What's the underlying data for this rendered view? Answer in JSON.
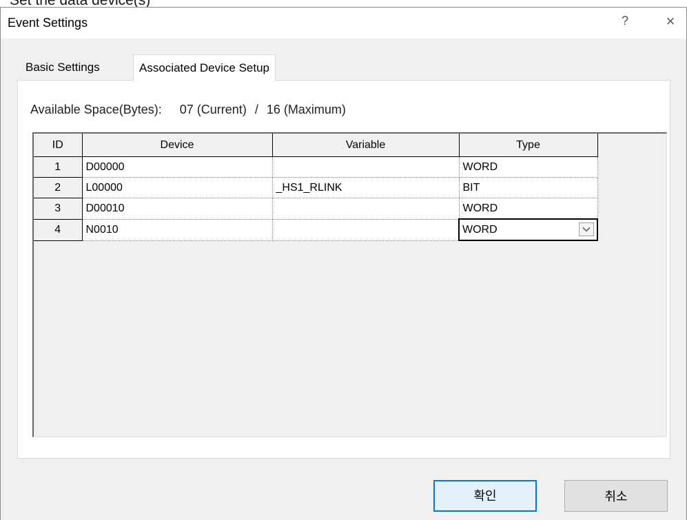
{
  "top_fragment": "Set the data device(s)",
  "dialog": {
    "title": "Event Settings",
    "help_glyph": "?",
    "close_glyph": "×"
  },
  "tabs": [
    {
      "label": "Basic Settings",
      "active": false
    },
    {
      "label": "Associated Device Setup",
      "active": true
    }
  ],
  "available_space": {
    "label": "Available Space(Bytes):",
    "current": "07 (Current)",
    "separator": "/",
    "maximum": "16 (Maximum)"
  },
  "grid": {
    "columns": [
      "ID",
      "Device",
      "Variable",
      "Type"
    ],
    "rows": [
      {
        "id": "1",
        "device": "D00000",
        "variable": "",
        "type": "WORD"
      },
      {
        "id": "2",
        "device": "L00000",
        "variable": "_HS1_RLINK",
        "type": "BIT"
      },
      {
        "id": "3",
        "device": "D00010",
        "variable": "",
        "type": "WORD"
      },
      {
        "id": "4",
        "device": "N0010",
        "variable": "",
        "type": "WORD"
      }
    ],
    "active_row": 4,
    "type_dropdown_icon": "chevron-down-icon"
  },
  "buttons": {
    "ok": "확인",
    "cancel": "취소"
  },
  "colors": {
    "dialog_bg": "#f0f0f0",
    "default_button_border": "#0078d7"
  }
}
